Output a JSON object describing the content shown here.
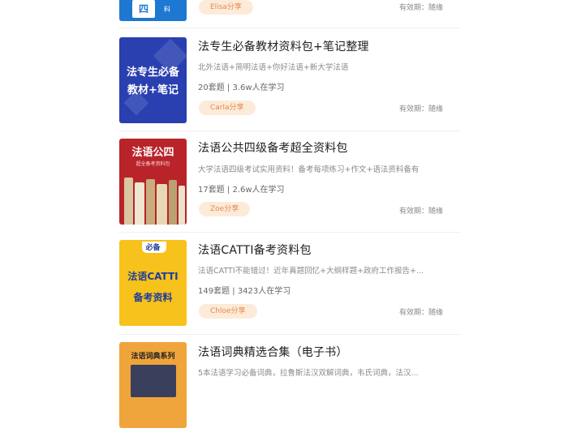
{
  "items": [
    {
      "title": "",
      "tag": "Elisa分享",
      "valid": "有效期：随缘",
      "cover": {
        "lines": [
          "四",
          "料"
        ],
        "color": "#1e78d2"
      }
    },
    {
      "title": "法专生必备教材资料包+笔记整理",
      "desc": "北外法语+简明法语+你好法语+新大学法语",
      "meta": "20套题 | 3.6w人在学习",
      "tag": "Carla分享",
      "valid": "有效期：随缘",
      "cover": {
        "lines": [
          "法专生必备",
          "教材+笔记"
        ],
        "color": "#2a3fb0"
      }
    },
    {
      "title": "法语公共四级备考超全资料包",
      "desc": "大学法语四级考试实用资料！备考每项练习+作文+语法资料备有",
      "meta": "17套题 | 2.6w人在学习",
      "tag": "Zoe分享",
      "valid": "有效期：随缘",
      "cover": {
        "lines": [
          "法语公四",
          "超全备考资料包"
        ],
        "color": "#b8242a"
      }
    },
    {
      "title": "法语CATTI备考资料包",
      "desc": "法语CATTI不能错过！近年真题回忆+大纲样题+政府工作报告+...",
      "meta": "149套题 | 3423人在学习",
      "tag": "Chloe分享",
      "valid": "有效期：随缘",
      "cover": {
        "lines": [
          "必备",
          "法语CATTI",
          "备考资料"
        ],
        "color": "#f6c21b"
      }
    },
    {
      "title": "法语词典精选合集（电子书）",
      "desc": "5本法语学习必备词典，拉鲁斯法汉双解词典，韦氏词典，法汉...",
      "cover": {
        "lines": [
          "法语词典系列"
        ],
        "color": "#f0a43c"
      }
    }
  ]
}
